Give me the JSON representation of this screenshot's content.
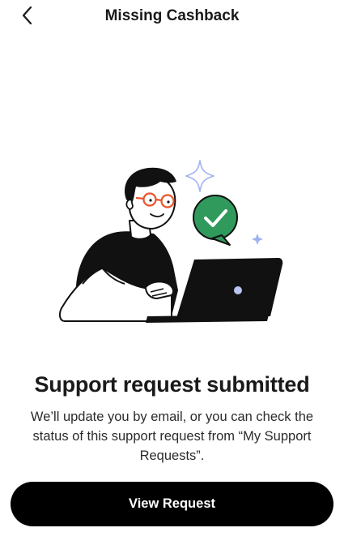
{
  "header": {
    "title": "Missing Cashback",
    "back_icon": "chevron-left-icon"
  },
  "illustration": {
    "icons": [
      "person-with-laptop",
      "check-bubble-icon",
      "sparkle-icon"
    ],
    "colors": {
      "check_bubble": "#2f9a5c",
      "glasses": "#e8542c",
      "sparkle": "#9fb2f0",
      "laptop_dot": "#b8c4f2",
      "ink": "#111111"
    }
  },
  "content": {
    "headline": "Support request submitted",
    "description": "We’ll update you by email, or you can check the status of this support request from “My Support Requests”."
  },
  "actions": {
    "view_request_label": "View Request"
  }
}
